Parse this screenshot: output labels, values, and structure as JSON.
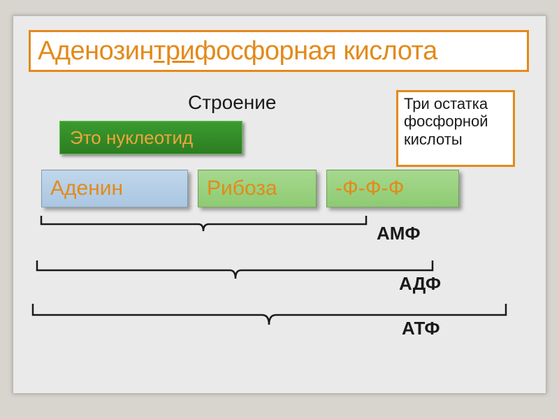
{
  "title": {
    "pre": "Аденозин",
    "underlined": "три",
    "post": "фосфорная кислота"
  },
  "subtitle": "Строение",
  "nucleotide_label": "Это нуклеотид",
  "phosphate_note": "Три остатка фосфорной кислоты",
  "components": {
    "adenine": "Аденин",
    "ribose": "Рибоза",
    "phosphates": "-Ф-Ф-Ф"
  },
  "braces": {
    "amf": "АМФ",
    "adf": "АДФ",
    "atf": "АТФ"
  },
  "colors": {
    "accent_orange": "#e38a1a",
    "green_dark": "#2c7d22",
    "green_light": "#a6d88f",
    "blue_light": "#a9c6e2",
    "background": "#eaeaea"
  }
}
